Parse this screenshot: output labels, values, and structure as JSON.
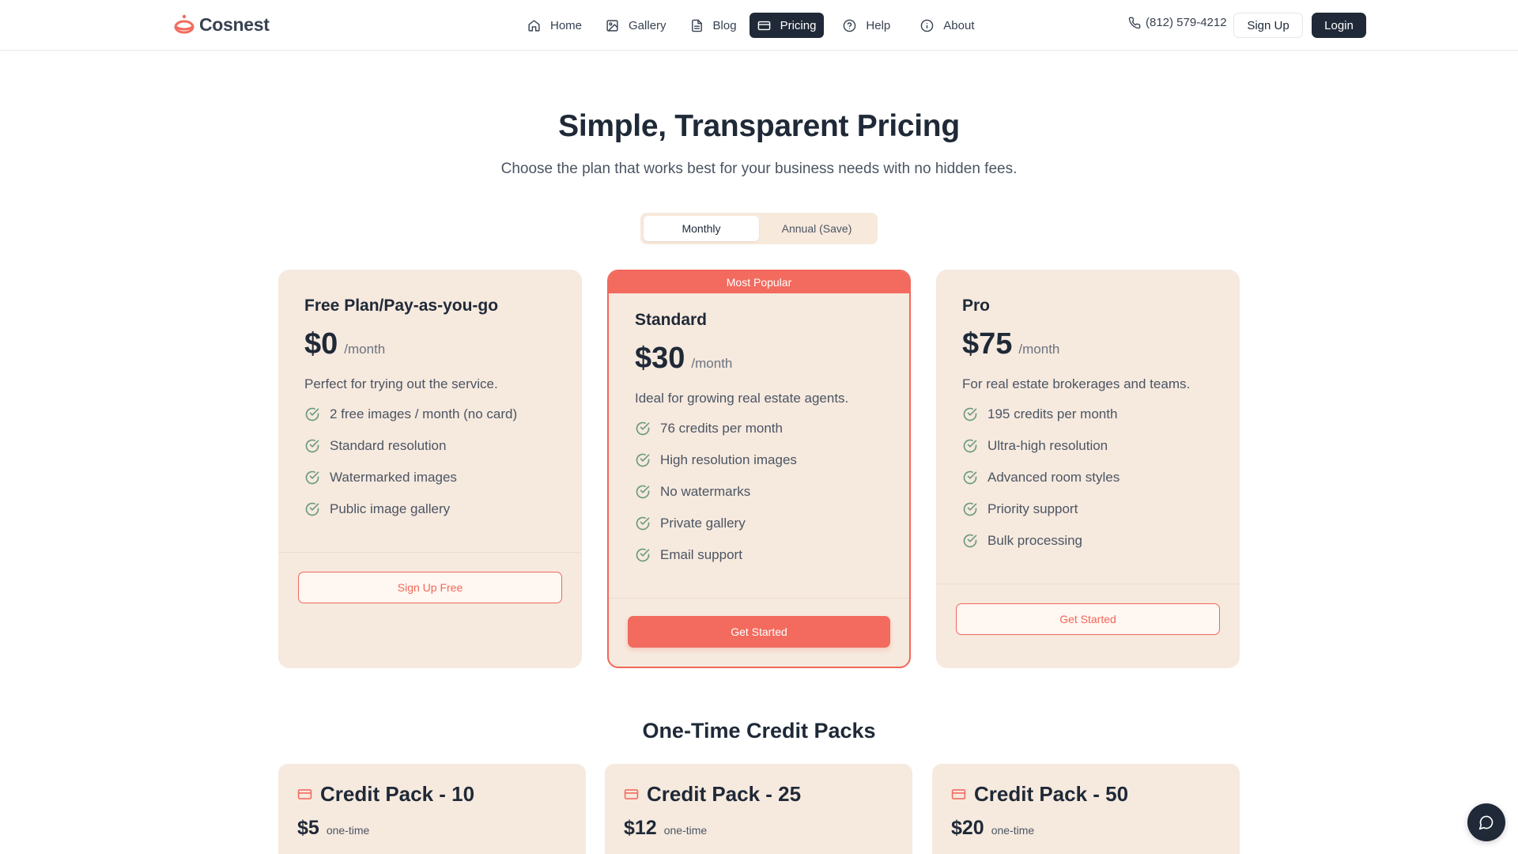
{
  "brand": {
    "name": "Cosnest",
    "accent": "#f26b5e",
    "dark": "#1f2937"
  },
  "nav": {
    "items": [
      {
        "label": "Home",
        "icon": "home-icon"
      },
      {
        "label": "Gallery",
        "icon": "image-icon"
      },
      {
        "label": "Blog",
        "icon": "document-icon"
      },
      {
        "label": "Pricing",
        "icon": "credit-card-icon",
        "active": true
      },
      {
        "label": "Help",
        "icon": "help-circle-icon"
      },
      {
        "label": "About",
        "icon": "info-icon"
      }
    ],
    "phone": "(812) 579-4212",
    "signup": "Sign Up",
    "login": "Login"
  },
  "hero": {
    "title": "Simple, Transparent Pricing",
    "subtitle": "Choose the plan that works best for your business needs with no hidden fees."
  },
  "billing_toggle": {
    "monthly": "Monthly",
    "annual": "Annual (Save)",
    "selected": "Monthly"
  },
  "plans": [
    {
      "name": "Free Plan/Pay-as-you-go",
      "price": "$0",
      "period": "/month",
      "description": "Perfect for trying out the service.",
      "features": [
        "2 free images / month (no card)",
        "Standard resolution",
        "Watermarked images",
        "Public image gallery"
      ],
      "cta": "Sign Up Free"
    },
    {
      "badge": "Most Popular",
      "name": "Standard",
      "price": "$30",
      "period": "/month",
      "description": "Ideal for growing real estate agents.",
      "features": [
        "76 credits per month",
        "High resolution images",
        "No watermarks",
        "Private gallery",
        "Email support"
      ],
      "cta": "Get Started"
    },
    {
      "name": "Pro",
      "price": "$75",
      "period": "/month",
      "description": "For real estate brokerages and teams.",
      "features": [
        "195 credits per month",
        "Ultra-high resolution",
        "Advanced room styles",
        "Priority support",
        "Bulk processing"
      ],
      "cta": "Get Started"
    }
  ],
  "credit_packs": {
    "title": "One-Time Credit Packs",
    "packs": [
      {
        "name": "Credit Pack - 10",
        "price": "$5",
        "period": "one-time"
      },
      {
        "name": "Credit Pack - 25",
        "price": "$12",
        "period": "one-time"
      },
      {
        "name": "Credit Pack - 50",
        "price": "$20",
        "period": "one-time"
      }
    ]
  },
  "chat": {
    "icon": "chat-bubble-icon"
  }
}
